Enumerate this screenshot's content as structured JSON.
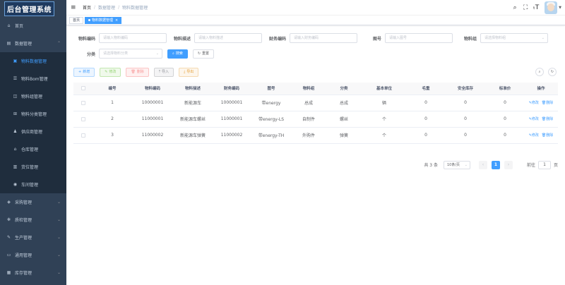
{
  "logo": "后台管理系统",
  "sidebar": {
    "items": [
      {
        "label": "首页",
        "icon": "home-icon"
      },
      {
        "label": "数据管理",
        "icon": "data-icon",
        "expanded": true
      },
      {
        "label": "采购管理",
        "icon": "cart-icon"
      },
      {
        "label": "质检管理",
        "icon": "gear-icon"
      },
      {
        "label": "生产管理",
        "icon": "pen-icon"
      },
      {
        "label": "通用管理",
        "icon": "folder-icon"
      },
      {
        "label": "库存管理",
        "icon": "box-icon"
      }
    ],
    "sub": [
      {
        "label": "物料数据管理",
        "active": true
      },
      {
        "label": "物料Bom管理"
      },
      {
        "label": "物料组管理"
      },
      {
        "label": "物料分类管理"
      },
      {
        "label": "供应商管理"
      },
      {
        "label": "仓库管理"
      },
      {
        "label": "货位管理"
      },
      {
        "label": "车间管理"
      }
    ]
  },
  "breadcrumb": [
    "首页",
    "数据管理",
    "物料数据管理"
  ],
  "tags": [
    "首页",
    "物料数据管理"
  ],
  "filters": {
    "material_code": {
      "label": "物料编码",
      "placeholder": "请输入物料编码"
    },
    "material_desc": {
      "label": "物料描述",
      "placeholder": "请输入物料描述"
    },
    "finance_code": {
      "label": "财务编码",
      "placeholder": "请输入财务编码"
    },
    "drawing_no": {
      "label": "图号",
      "placeholder": "请输入图号"
    },
    "material_group": {
      "label": "物料组",
      "placeholder": "请选择物料组"
    },
    "category": {
      "label": "分类",
      "placeholder": "请选择物料分类"
    },
    "search_btn": "搜索",
    "reset_btn": "重置"
  },
  "toolbar": {
    "add": "新增",
    "edit": "修改",
    "delete": "删除",
    "import": "导入",
    "export": "导出"
  },
  "table": {
    "headers": [
      "编号",
      "物料编码",
      "物料描述",
      "财务编码",
      "图号",
      "物料组",
      "分类",
      "基本单位",
      "毛重",
      "安全库存",
      "标准价",
      "操作"
    ],
    "rows": [
      [
        "1",
        "10000001",
        "新能源车",
        "10000001",
        "带energy",
        "总成",
        "总成",
        "辆",
        "0",
        "0",
        "0"
      ],
      [
        "2",
        "11000001",
        "新能源车螺丝",
        "11000001",
        "带energy-LS",
        "自制件",
        "螺丝",
        "个",
        "0",
        "0",
        "0"
      ],
      [
        "3",
        "11000002",
        "新能源车弹簧",
        "11000002",
        "带energy-TH",
        "外购件",
        "弹簧",
        "个",
        "0",
        "0",
        "0"
      ]
    ],
    "op_edit": "修改",
    "op_delete": "删除"
  },
  "pagination": {
    "total": "共 3 条",
    "page_size": "10条/页",
    "current": "1",
    "goto_label": "前往",
    "goto_value": "1",
    "page_suffix": "页"
  },
  "colors": {
    "sidebar_bg": "#304156",
    "primary": "#409eff"
  }
}
